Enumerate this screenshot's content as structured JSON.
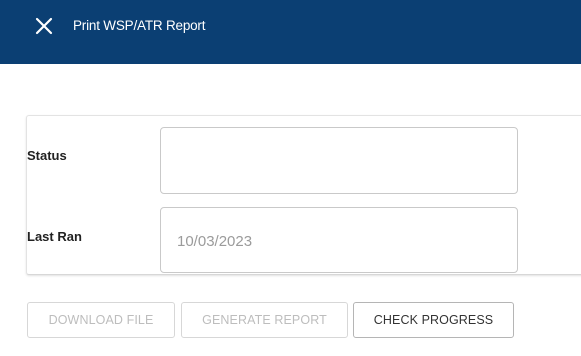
{
  "header": {
    "title": "Print WSP/ATR Report",
    "close_icon": "close-icon",
    "background_color": "#0b3f73"
  },
  "form": {
    "status": {
      "label": "Status",
      "value": ""
    },
    "last_ran": {
      "label": "Last Ran",
      "value": "10/03/2023"
    }
  },
  "actions": {
    "download_file": {
      "label": "DOWNLOAD FILE",
      "enabled": false
    },
    "generate_report": {
      "label": "GENERATE REPORT",
      "enabled": false
    },
    "check_progress": {
      "label": "CHECK PROGRESS",
      "enabled": true
    }
  }
}
